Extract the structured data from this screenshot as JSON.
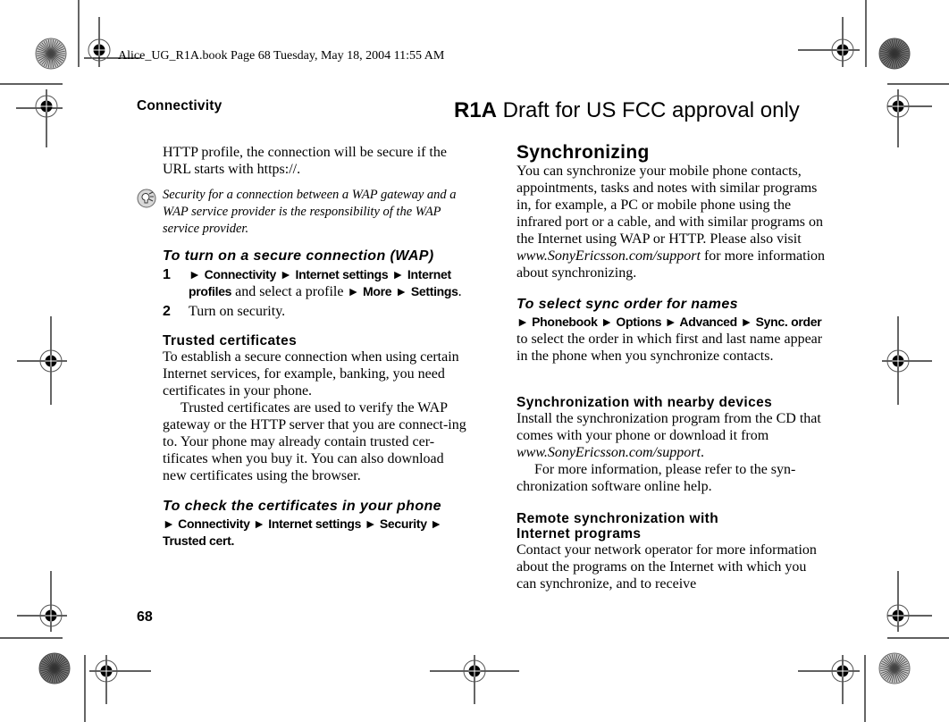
{
  "slug": "Alice_UG_R1A.book  Page 68  Tuesday, May 18, 2004  11:55 AM",
  "header": {
    "section": "Connectivity",
    "draft_bold": "R1A",
    "draft_rest": " Draft for US FCC approval only"
  },
  "page_number": "68",
  "left_column": {
    "intro": "HTTP profile, the connection will be secure if the URL starts with https://.",
    "tip_icon": "lightbulb-tip-icon",
    "tip": "Security for a connection between a WAP gateway and a WAP service provider is the responsibility of the WAP service provider.",
    "secure_heading": "To turn on a secure connection (WAP)",
    "steps": [
      {
        "num": "1",
        "arrow1": "►",
        "menu1": "Connectivity",
        "arrow2": "►",
        "menu2": "Internet settings",
        "arrow3": "►",
        "menu3": "Internet profiles",
        "text1": " and select a profile ",
        "arrow4": "►",
        "menu4": "More",
        "arrow5": "►",
        "menu5": "Settings",
        "end": "."
      },
      {
        "num": "2",
        "text": "Turn on security."
      }
    ],
    "trusted_heading": "Trusted certificates",
    "trusted_p1": "To establish a secure connection when using certain Internet services, for example, banking, you need certificates in your phone.",
    "trusted_p2": "Trusted certificates are used to verify the WAP gateway or the HTTP server that you are connect-ing to. Your phone may already contain trusted cer-tificates when you buy it. You can also download new certificates using the browser.",
    "check_heading": "To check the certificates in your phone",
    "check_path": "► Connectivity ► Internet settings ► Security ► Trusted cert."
  },
  "right_column": {
    "sync_heading": "Synchronizing",
    "sync_p1": "You can synchronize your mobile phone contacts, appointments, tasks and notes with similar programs in, for example, a PC or mobile phone using the infrared port or a cable, and with similar programs on the Internet using WAP or HTTP. Please also visit ",
    "sync_link": "www.SonyEricsson.com/support",
    "sync_p1_end": " for more information about synchronizing.",
    "order_heading": "To select sync order for names",
    "order_path": "► Phonebook ► Options ► Advanced ► Sync. order",
    "order_text": "to select the order in which first and last name appear in the phone when you synchronize contacts.",
    "nearby_heading": "Synchronization with nearby devices",
    "nearby_p1": "Install the synchronization program from the CD that comes with your phone or download it from ",
    "nearby_link": "www.SonyEricsson.com/support",
    "nearby_p1_end": ".",
    "nearby_p2": "For more information, please refer to the syn-chronization software online help.",
    "remote_heading": "Remote synchronization with Internet programs",
    "remote_p1": "Contact your network operator for more information about the programs on the Internet with which you can synchronize, and to receive"
  }
}
